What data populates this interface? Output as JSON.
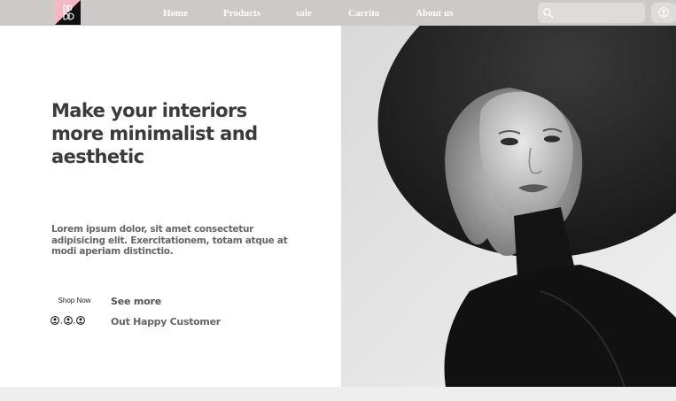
{
  "nav": {
    "items": [
      {
        "label": "Home"
      },
      {
        "label": "Products"
      },
      {
        "label": "sale"
      },
      {
        "label": "Carrito"
      },
      {
        "label": "About us"
      }
    ]
  },
  "search": {
    "placeholder": "",
    "value": ""
  },
  "hero": {
    "title": "Make your interiors more minimalist and aesthetic",
    "text": "Lorem ipsum dolor, sit amet consectetur adipisicing elit. Exercitationem, totam atque at modi aperiam distinctio.",
    "shop_now_label": "Shop Now",
    "see_more_label": "See more",
    "customers_label": "Out Happy Customer",
    "customers_separator": ","
  },
  "colors": {
    "topbar": "#cdc9c9",
    "logo_pink": "#f2b9c5",
    "heading": "#3b3b3b",
    "body_text": "#666666"
  }
}
